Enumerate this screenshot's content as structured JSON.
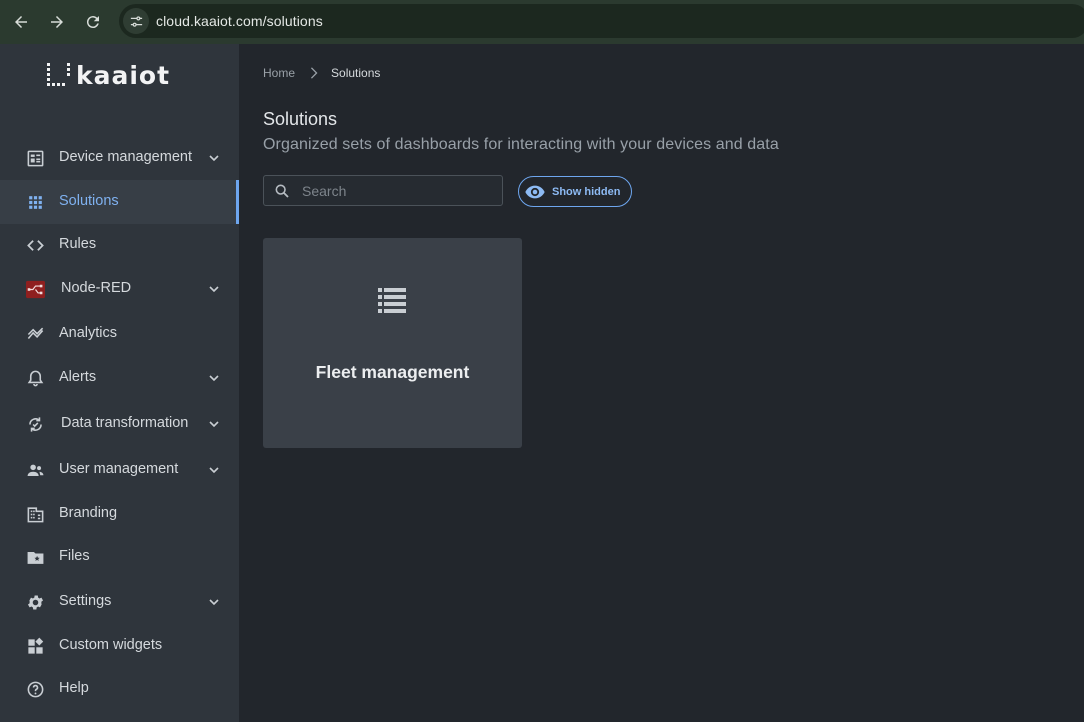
{
  "browser": {
    "url": "cloud.kaaiot.com/solutions"
  },
  "logo": {
    "text": "kaaiot"
  },
  "sidebar": {
    "items": [
      {
        "label": "Device management",
        "icon": "device-management-icon",
        "expandable": true,
        "active": false
      },
      {
        "label": "Solutions",
        "icon": "grid-icon",
        "expandable": false,
        "active": true
      },
      {
        "label": "Rules",
        "icon": "code-icon",
        "expandable": false,
        "active": false
      },
      {
        "label": "Node-RED",
        "icon": "node-red-icon",
        "expandable": true,
        "active": false
      },
      {
        "label": "Analytics",
        "icon": "analytics-icon",
        "expandable": false,
        "active": false
      },
      {
        "label": "Alerts",
        "icon": "bell-icon",
        "expandable": true,
        "active": false
      },
      {
        "label": "Data transformation",
        "icon": "data-transformation-icon",
        "expandable": true,
        "active": false
      },
      {
        "label": "User management",
        "icon": "users-icon",
        "expandable": true,
        "active": false
      },
      {
        "label": "Branding",
        "icon": "building-icon",
        "expandable": false,
        "active": false
      },
      {
        "label": "Files",
        "icon": "folder-star-icon",
        "expandable": false,
        "active": false
      },
      {
        "label": "Settings",
        "icon": "gear-icon",
        "expandable": true,
        "active": false
      },
      {
        "label": "Custom widgets",
        "icon": "widgets-icon",
        "expandable": false,
        "active": false
      },
      {
        "label": "Help",
        "icon": "help-icon",
        "expandable": false,
        "active": false
      }
    ]
  },
  "breadcrumb": {
    "home": "Home",
    "current": "Solutions"
  },
  "main": {
    "title": "Solutions",
    "subtitle": "Organized sets of dashboards for interacting with your devices and data",
    "search_placeholder": "Search",
    "show_hidden_label": "Show hidden",
    "cards": [
      {
        "title": "Fleet management",
        "icon": "list-icon"
      }
    ]
  },
  "colors": {
    "accent": "#6ea6ef",
    "sidebar_bg": "#2f353c",
    "main_bg": "#22262c",
    "card_bg": "#3a4048"
  }
}
